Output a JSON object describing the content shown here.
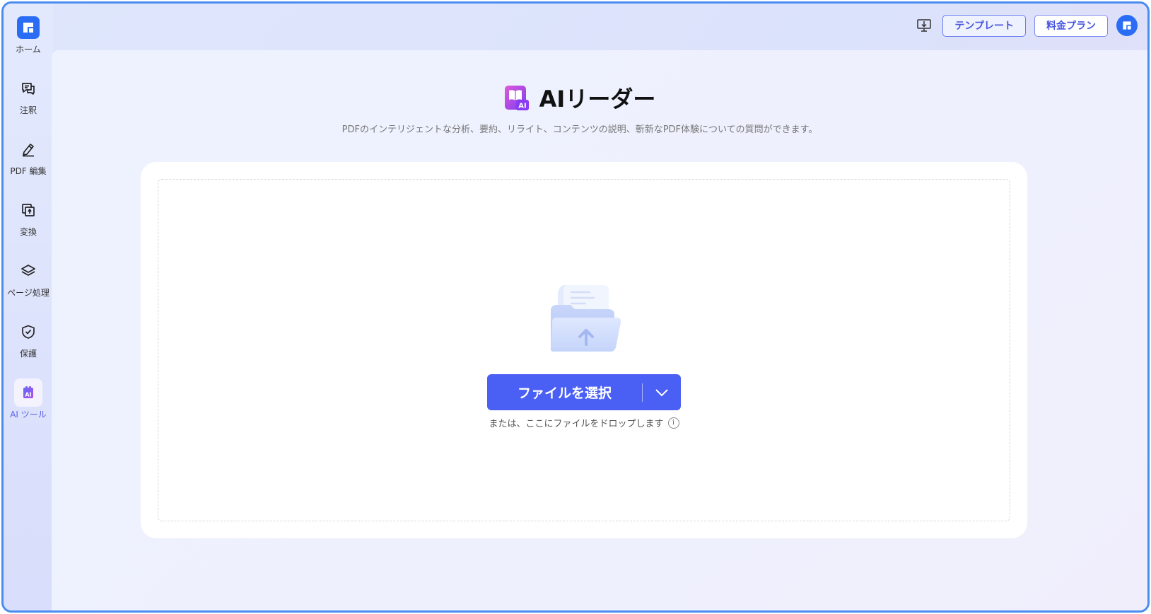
{
  "sidebar": {
    "items": [
      {
        "label": "ホーム",
        "icon": "home-logo-icon"
      },
      {
        "label": "注釈",
        "icon": "annotation-icon"
      },
      {
        "label": "PDF 編集",
        "icon": "edit-icon"
      },
      {
        "label": "変換",
        "icon": "convert-icon"
      },
      {
        "label": "ページ処理",
        "icon": "layers-icon"
      },
      {
        "label": "保護",
        "icon": "shield-icon"
      },
      {
        "label": "AI ツール",
        "icon": "ai-tool-icon"
      }
    ],
    "active_index": 6
  },
  "topbar": {
    "template_label": "テンプレート",
    "pricing_label": "料金プラン"
  },
  "main": {
    "title": "AIリーダー",
    "subtitle": "PDFのインテリジェントな分析、要約、リライト、コンテンツの説明、斬新なPDF体験についての質問ができます。",
    "select_button_label": "ファイルを選択",
    "drop_hint": "または、ここにファイルをドロップします",
    "info_glyph": "i"
  },
  "colors": {
    "accent": "#4a5ff4",
    "brand_blue": "#2a6df4",
    "frame_border": "#4a8cf0"
  }
}
